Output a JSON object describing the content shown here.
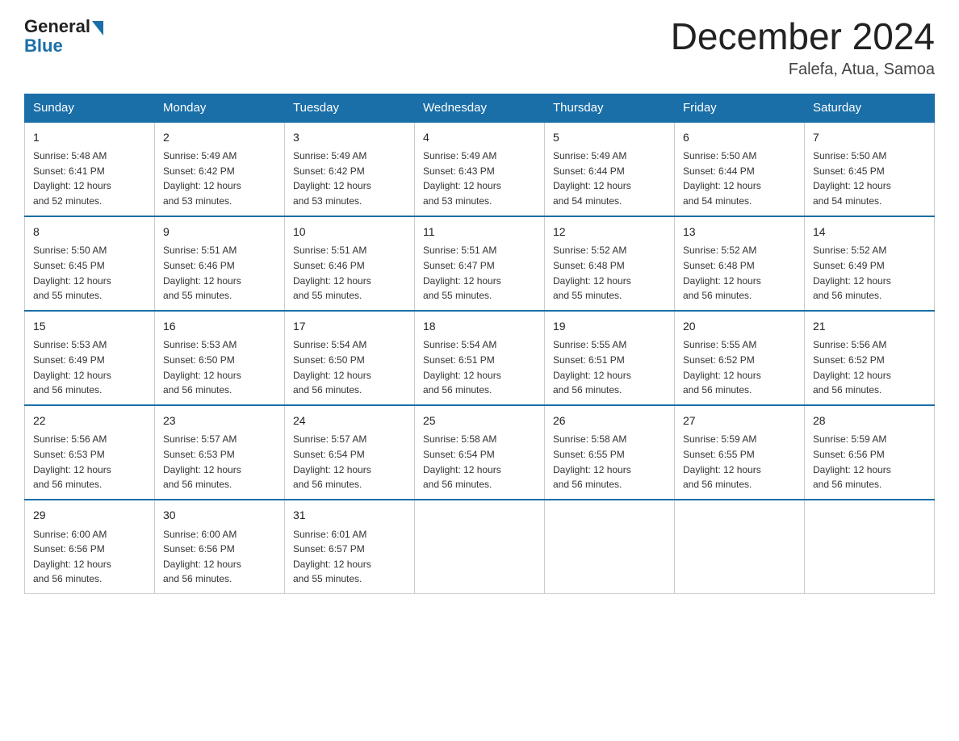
{
  "header": {
    "logo_general": "General",
    "logo_blue": "Blue",
    "month_title": "December 2024",
    "location": "Falefa, Atua, Samoa"
  },
  "days_of_week": [
    "Sunday",
    "Monday",
    "Tuesday",
    "Wednesday",
    "Thursday",
    "Friday",
    "Saturday"
  ],
  "weeks": [
    [
      {
        "num": "1",
        "info": "Sunrise: 5:48 AM\nSunset: 6:41 PM\nDaylight: 12 hours\nand 52 minutes."
      },
      {
        "num": "2",
        "info": "Sunrise: 5:49 AM\nSunset: 6:42 PM\nDaylight: 12 hours\nand 53 minutes."
      },
      {
        "num": "3",
        "info": "Sunrise: 5:49 AM\nSunset: 6:42 PM\nDaylight: 12 hours\nand 53 minutes."
      },
      {
        "num": "4",
        "info": "Sunrise: 5:49 AM\nSunset: 6:43 PM\nDaylight: 12 hours\nand 53 minutes."
      },
      {
        "num": "5",
        "info": "Sunrise: 5:49 AM\nSunset: 6:44 PM\nDaylight: 12 hours\nand 54 minutes."
      },
      {
        "num": "6",
        "info": "Sunrise: 5:50 AM\nSunset: 6:44 PM\nDaylight: 12 hours\nand 54 minutes."
      },
      {
        "num": "7",
        "info": "Sunrise: 5:50 AM\nSunset: 6:45 PM\nDaylight: 12 hours\nand 54 minutes."
      }
    ],
    [
      {
        "num": "8",
        "info": "Sunrise: 5:50 AM\nSunset: 6:45 PM\nDaylight: 12 hours\nand 55 minutes."
      },
      {
        "num": "9",
        "info": "Sunrise: 5:51 AM\nSunset: 6:46 PM\nDaylight: 12 hours\nand 55 minutes."
      },
      {
        "num": "10",
        "info": "Sunrise: 5:51 AM\nSunset: 6:46 PM\nDaylight: 12 hours\nand 55 minutes."
      },
      {
        "num": "11",
        "info": "Sunrise: 5:51 AM\nSunset: 6:47 PM\nDaylight: 12 hours\nand 55 minutes."
      },
      {
        "num": "12",
        "info": "Sunrise: 5:52 AM\nSunset: 6:48 PM\nDaylight: 12 hours\nand 55 minutes."
      },
      {
        "num": "13",
        "info": "Sunrise: 5:52 AM\nSunset: 6:48 PM\nDaylight: 12 hours\nand 56 minutes."
      },
      {
        "num": "14",
        "info": "Sunrise: 5:52 AM\nSunset: 6:49 PM\nDaylight: 12 hours\nand 56 minutes."
      }
    ],
    [
      {
        "num": "15",
        "info": "Sunrise: 5:53 AM\nSunset: 6:49 PM\nDaylight: 12 hours\nand 56 minutes."
      },
      {
        "num": "16",
        "info": "Sunrise: 5:53 AM\nSunset: 6:50 PM\nDaylight: 12 hours\nand 56 minutes."
      },
      {
        "num": "17",
        "info": "Sunrise: 5:54 AM\nSunset: 6:50 PM\nDaylight: 12 hours\nand 56 minutes."
      },
      {
        "num": "18",
        "info": "Sunrise: 5:54 AM\nSunset: 6:51 PM\nDaylight: 12 hours\nand 56 minutes."
      },
      {
        "num": "19",
        "info": "Sunrise: 5:55 AM\nSunset: 6:51 PM\nDaylight: 12 hours\nand 56 minutes."
      },
      {
        "num": "20",
        "info": "Sunrise: 5:55 AM\nSunset: 6:52 PM\nDaylight: 12 hours\nand 56 minutes."
      },
      {
        "num": "21",
        "info": "Sunrise: 5:56 AM\nSunset: 6:52 PM\nDaylight: 12 hours\nand 56 minutes."
      }
    ],
    [
      {
        "num": "22",
        "info": "Sunrise: 5:56 AM\nSunset: 6:53 PM\nDaylight: 12 hours\nand 56 minutes."
      },
      {
        "num": "23",
        "info": "Sunrise: 5:57 AM\nSunset: 6:53 PM\nDaylight: 12 hours\nand 56 minutes."
      },
      {
        "num": "24",
        "info": "Sunrise: 5:57 AM\nSunset: 6:54 PM\nDaylight: 12 hours\nand 56 minutes."
      },
      {
        "num": "25",
        "info": "Sunrise: 5:58 AM\nSunset: 6:54 PM\nDaylight: 12 hours\nand 56 minutes."
      },
      {
        "num": "26",
        "info": "Sunrise: 5:58 AM\nSunset: 6:55 PM\nDaylight: 12 hours\nand 56 minutes."
      },
      {
        "num": "27",
        "info": "Sunrise: 5:59 AM\nSunset: 6:55 PM\nDaylight: 12 hours\nand 56 minutes."
      },
      {
        "num": "28",
        "info": "Sunrise: 5:59 AM\nSunset: 6:56 PM\nDaylight: 12 hours\nand 56 minutes."
      }
    ],
    [
      {
        "num": "29",
        "info": "Sunrise: 6:00 AM\nSunset: 6:56 PM\nDaylight: 12 hours\nand 56 minutes."
      },
      {
        "num": "30",
        "info": "Sunrise: 6:00 AM\nSunset: 6:56 PM\nDaylight: 12 hours\nand 56 minutes."
      },
      {
        "num": "31",
        "info": "Sunrise: 6:01 AM\nSunset: 6:57 PM\nDaylight: 12 hours\nand 55 minutes."
      },
      {
        "num": "",
        "info": ""
      },
      {
        "num": "",
        "info": ""
      },
      {
        "num": "",
        "info": ""
      },
      {
        "num": "",
        "info": ""
      }
    ]
  ]
}
